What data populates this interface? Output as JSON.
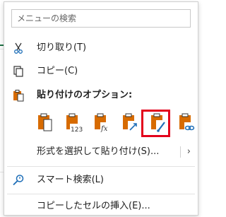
{
  "search": {
    "placeholder": "メニューの検索"
  },
  "menu": {
    "cut": "切り取り(T)",
    "copy": "コピー(C)",
    "paste_options": "貼り付けのオプション:",
    "paste_buttons": [
      {
        "name": "paste"
      },
      {
        "name": "paste-values"
      },
      {
        "name": "paste-formulas"
      },
      {
        "name": "paste-transpose"
      },
      {
        "name": "paste-formatting"
      },
      {
        "name": "paste-link"
      }
    ],
    "paste_special": "形式を選択して貼り付け(S)...",
    "smart_lookup": "スマート検索(L)",
    "insert_copied": "コピーしたセルの挿入(E)..."
  },
  "colors": {
    "accent": "#d76b00",
    "highlight": "#e3001b",
    "blue": "#1f6fb8"
  }
}
